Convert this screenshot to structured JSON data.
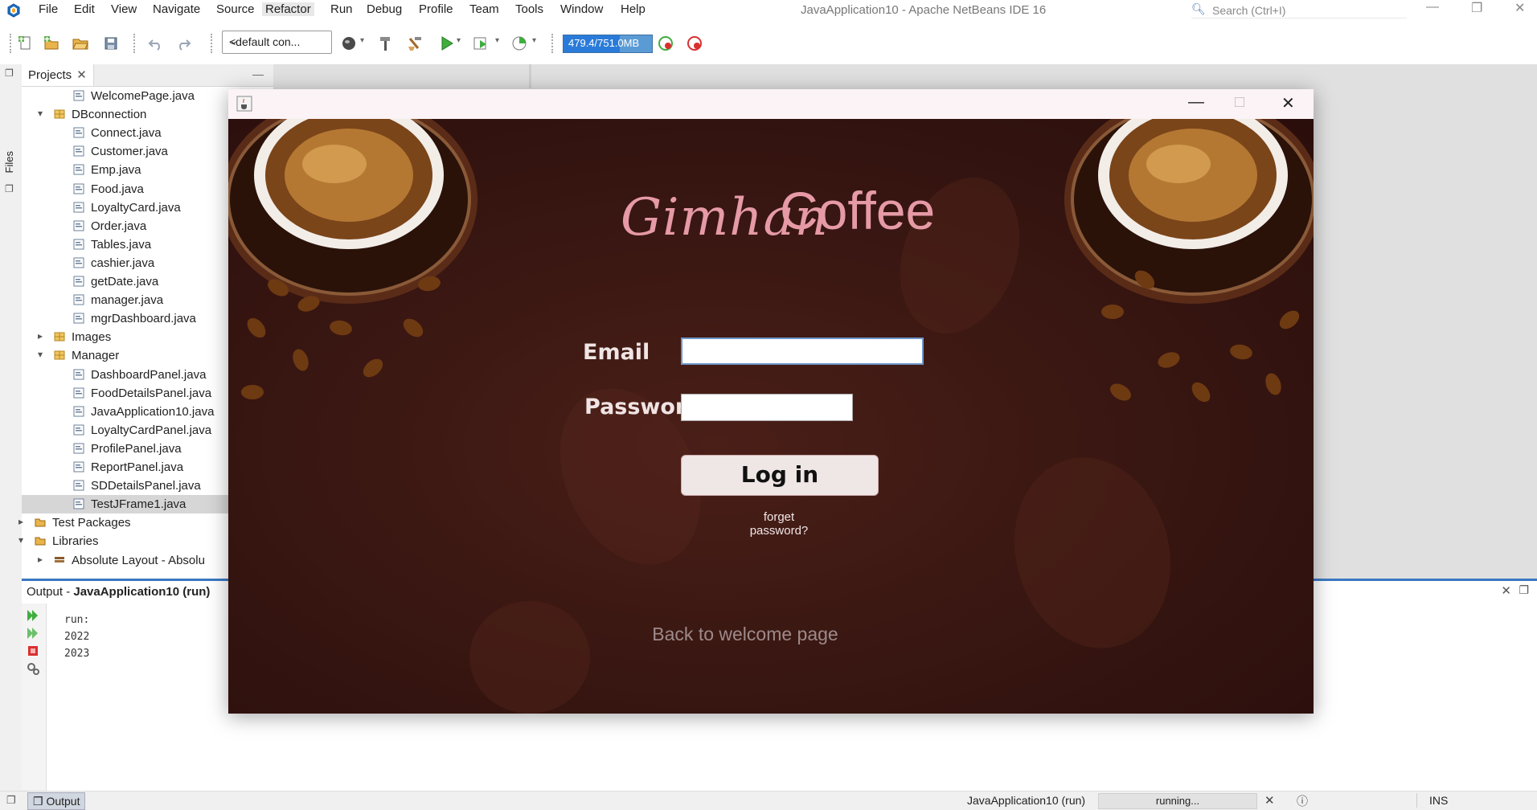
{
  "menubar": {
    "items": [
      "File",
      "Edit",
      "View",
      "Navigate",
      "Source",
      "Refactor",
      "Run",
      "Debug",
      "Profile",
      "Team",
      "Tools",
      "Window",
      "Help"
    ],
    "window_title": "JavaApplication10 - Apache NetBeans IDE 16",
    "search_placeholder": "Search (Ctrl+I)"
  },
  "toolbar": {
    "config": "<default con...",
    "memory": "479.4/751.0MB",
    "memory_fraction": 0.64,
    "icons": [
      "new-file-icon",
      "new-project-icon",
      "open-project-icon",
      "save-all-icon",
      "undo-icon",
      "redo-icon",
      "globe-icon",
      "build-hammer-icon",
      "clean-build-icon",
      "run-icon",
      "debug-icon",
      "profile-icon",
      "gc-icon",
      "pause-profiling-icon"
    ]
  },
  "side": {
    "files_tab": "Files"
  },
  "projects": {
    "tab_label": "Projects",
    "rows": [
      {
        "label": "WelcomePage.java",
        "indent": 3,
        "type": "file"
      },
      {
        "label": "DBconnection",
        "indent": 2,
        "type": "package",
        "arrow": "▾"
      },
      {
        "label": "Connect.java",
        "indent": 3,
        "type": "file"
      },
      {
        "label": "Customer.java",
        "indent": 3,
        "type": "file"
      },
      {
        "label": "Emp.java",
        "indent": 3,
        "type": "file"
      },
      {
        "label": "Food.java",
        "indent": 3,
        "type": "file"
      },
      {
        "label": "LoyaltyCard.java",
        "indent": 3,
        "type": "file"
      },
      {
        "label": "Order.java",
        "indent": 3,
        "type": "file"
      },
      {
        "label": "Tables.java",
        "indent": 3,
        "type": "file"
      },
      {
        "label": "cashier.java",
        "indent": 3,
        "type": "file"
      },
      {
        "label": "getDate.java",
        "indent": 3,
        "type": "file"
      },
      {
        "label": "manager.java",
        "indent": 3,
        "type": "file"
      },
      {
        "label": "mgrDashboard.java",
        "indent": 3,
        "type": "file"
      },
      {
        "label": "Images",
        "indent": 2,
        "type": "package",
        "arrow": "▸"
      },
      {
        "label": "Manager",
        "indent": 2,
        "type": "package",
        "arrow": "▾"
      },
      {
        "label": "DashboardPanel.java",
        "indent": 3,
        "type": "file"
      },
      {
        "label": "FoodDetailsPanel.java",
        "indent": 3,
        "type": "file"
      },
      {
        "label": "JavaApplication10.java",
        "indent": 3,
        "type": "file"
      },
      {
        "label": "LoyaltyCardPanel.java",
        "indent": 3,
        "type": "file"
      },
      {
        "label": "ProfilePanel.java",
        "indent": 3,
        "type": "file"
      },
      {
        "label": "ReportPanel.java",
        "indent": 3,
        "type": "file"
      },
      {
        "label": "SDDetailsPanel.java",
        "indent": 3,
        "type": "file"
      },
      {
        "label": "TestJFrame1.java",
        "indent": 3,
        "type": "file",
        "selected": true
      },
      {
        "label": "Test Packages",
        "indent": 1,
        "type": "folder",
        "arrow": "▸"
      },
      {
        "label": "Libraries",
        "indent": 1,
        "type": "folder",
        "arrow": "▾"
      },
      {
        "label": "Absolute Layout - Absolu",
        "indent": 2,
        "type": "jar",
        "arrow": "▸"
      }
    ]
  },
  "output": {
    "title_prefix": "Output - ",
    "title_bold": "JavaApplication10 (run)",
    "lines": [
      "run:",
      "2022",
      "2023"
    ]
  },
  "statusbar": {
    "output_tab": "Output",
    "process": "JavaApplication10 (run)",
    "progress_text": "running...",
    "mode": "INS"
  },
  "login": {
    "brand_script": "Gimhan",
    "brand_name": "Coffee",
    "email_label": "Email",
    "password_label": "Password",
    "email_value": "",
    "password_value": "",
    "login_button": "Log in",
    "forgot": "forget password?",
    "back": "Back to welcome page"
  },
  "colors": {
    "accent": "#3a78c2",
    "brand_pink": "#e69aa6",
    "login_bg": "#3a1712",
    "memory_fill": "#2a7bd9"
  }
}
